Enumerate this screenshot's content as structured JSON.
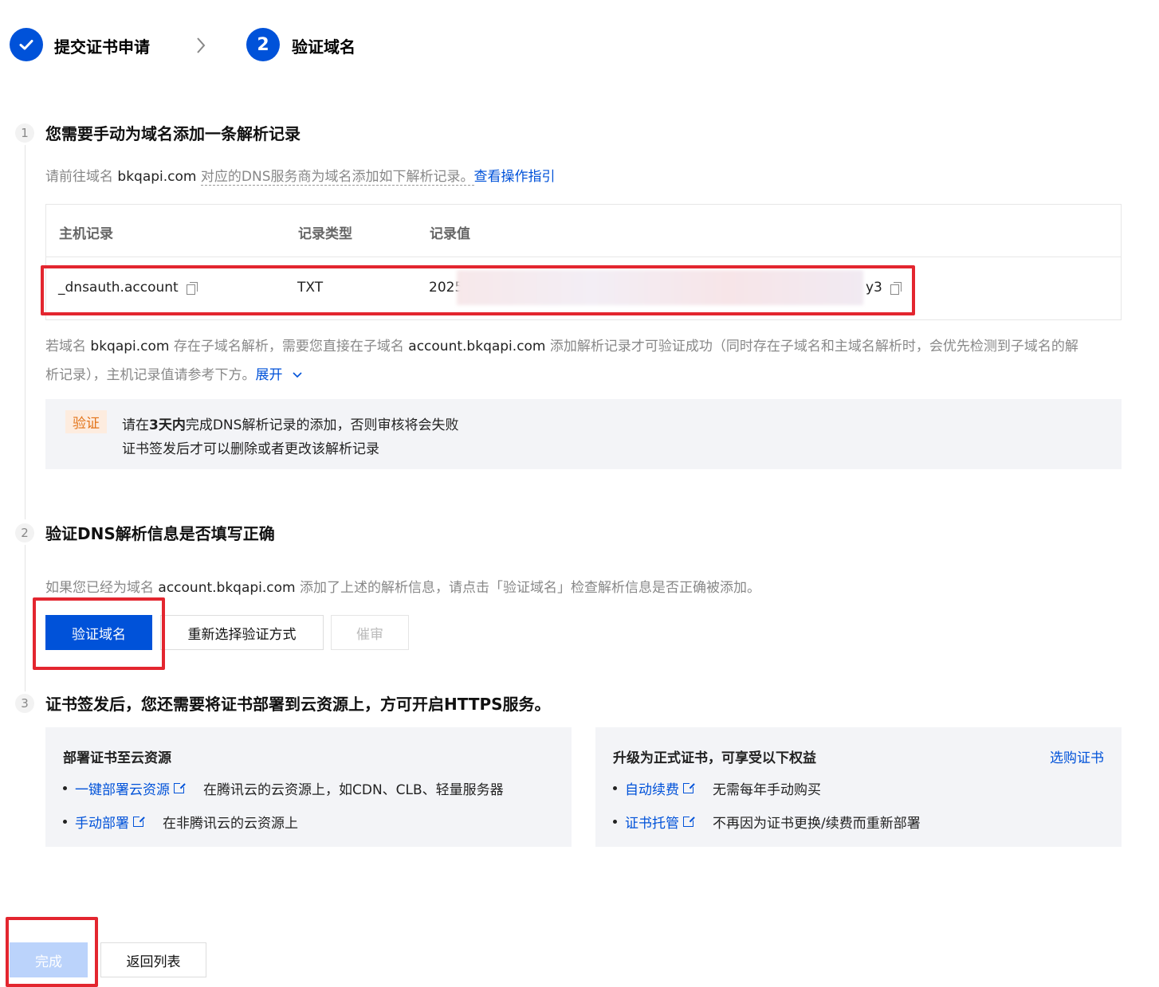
{
  "steps": [
    {
      "label": "提交证书申请",
      "state": "done"
    },
    {
      "number": "2",
      "label": "验证域名",
      "state": "active"
    }
  ],
  "section1": {
    "number": "1",
    "title": "您需要手动为域名添加一条解析记录",
    "desc_prefix": "请前往域名",
    "desc_domain": "bkqapi.com",
    "desc_middle": "对应的DNS服务商为域名添加如下解析记录。",
    "desc_link": "查看操作指引",
    "table": {
      "headers": [
        "主机记录",
        "记录类型",
        "记录值"
      ],
      "row": {
        "host": "_dnsauth.account",
        "type": "TXT",
        "value_start": "2025",
        "value_end": "y3"
      }
    },
    "sub_note": {
      "p1": "若域名",
      "d1": "bkqapi.com",
      "p2": "存在子域名解析，需要您直接在子域名",
      "d2": "account.bkqapi.com",
      "p3": "添加解析记录才可验证成功（同时存在子域名和主域名解析时，会优先检测到子域名的解",
      "p4": "析记录），主机记录值请参考下方。",
      "expand": "展开"
    },
    "notice": {
      "tag": "验证",
      "line1_pre": "请在",
      "line1_bold": "3天内",
      "line1_post": "完成DNS解析记录的添加，否则审核将会失败",
      "line2": "证书签发后才可以删除或者更改该解析记录"
    }
  },
  "section2": {
    "number": "2",
    "title": "验证DNS解析信息是否填写正确",
    "desc_prefix": "如果您已经为域名",
    "desc_domain": "account.bkqapi.com",
    "desc_suffix": "添加了上述的解析信息，请点击「验证域名」检查解析信息是否正确被添加。",
    "buttons": {
      "verify": "验证域名",
      "reselect": "重新选择验证方式",
      "urge": "催审"
    }
  },
  "section3": {
    "number": "3",
    "title": "证书签发后，您还需要将证书部署到云资源上，方可开启HTTPS服务。",
    "left_panel": {
      "title": "部署证书至云资源",
      "items": [
        {
          "link": "一键部署云资源",
          "text": "在腾讯云的云资源上，如CDN、CLB、轻量服务器"
        },
        {
          "link": "手动部署",
          "text": "在非腾讯云的云资源上"
        }
      ]
    },
    "right_panel": {
      "title": "升级为正式证书，可享受以下权益",
      "action": "选购证书",
      "items": [
        {
          "link": "自动续费",
          "text": "无需每年手动购买"
        },
        {
          "link": "证书托管",
          "text": "不再因为证书更换/续费而重新部署"
        }
      ]
    }
  },
  "footer": {
    "done": "完成",
    "back": "返回列表"
  },
  "colors": {
    "primary": "#0052d9",
    "highlight": "#e3262f",
    "warning": "#e37318"
  }
}
